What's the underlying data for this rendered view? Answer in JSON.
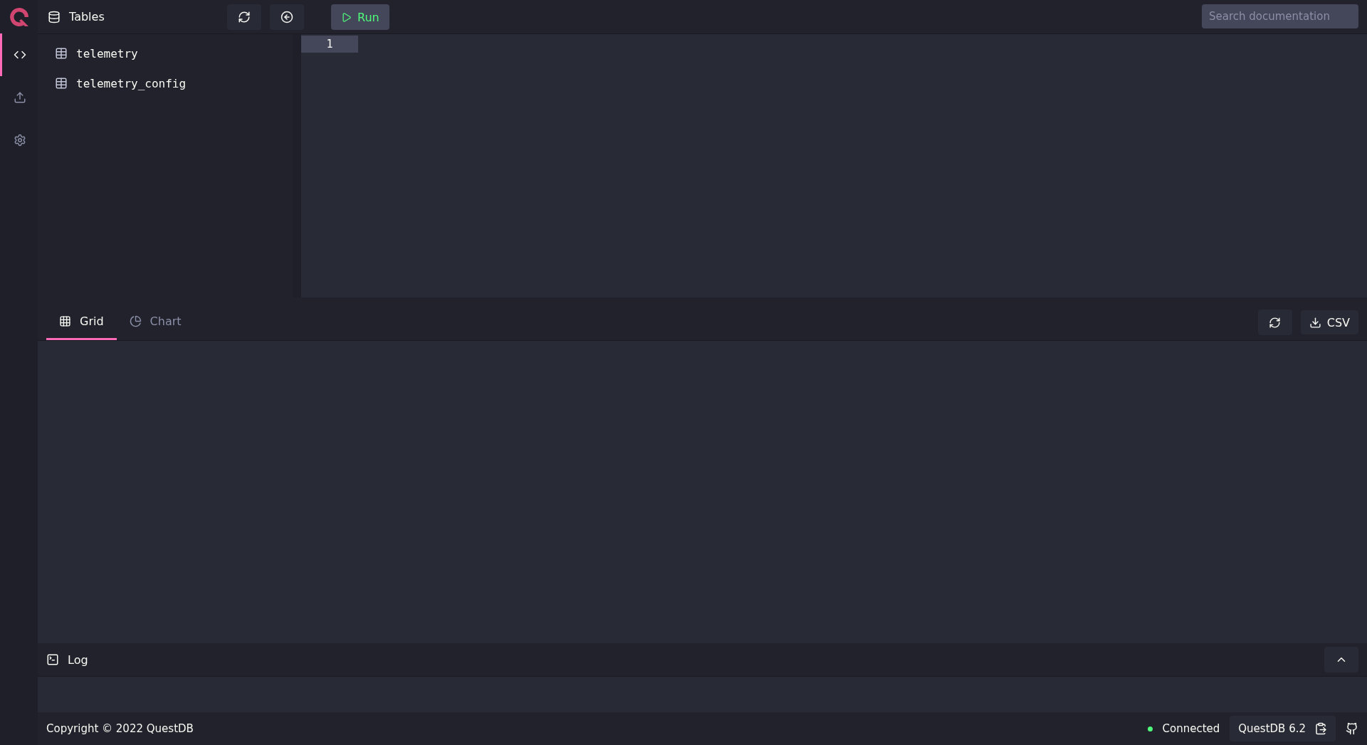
{
  "nav": [
    {
      "kind": "code",
      "selected": true
    },
    {
      "kind": "upload",
      "selected": false
    },
    {
      "kind": "settings",
      "selected": false
    }
  ],
  "tables_panel": {
    "title": "Tables",
    "items": [
      "telemetry",
      "telemetry_config"
    ]
  },
  "toolbar": {
    "run_label": "Run",
    "search": {
      "placeholder": "Search documentation"
    }
  },
  "editor": {
    "line_numbers": [
      "1"
    ]
  },
  "result_tabs": [
    {
      "label": "Grid",
      "kind": "grid",
      "selected": true
    },
    {
      "label": "Chart",
      "kind": "chart",
      "selected": false
    }
  ],
  "result_actions": {
    "csv_label": "CSV"
  },
  "log": {
    "title": "Log",
    "expanded": false
  },
  "footer": {
    "copyright": "Copyright © 2022 QuestDB",
    "status": "Connected",
    "version": "QuestDB 6.2"
  }
}
